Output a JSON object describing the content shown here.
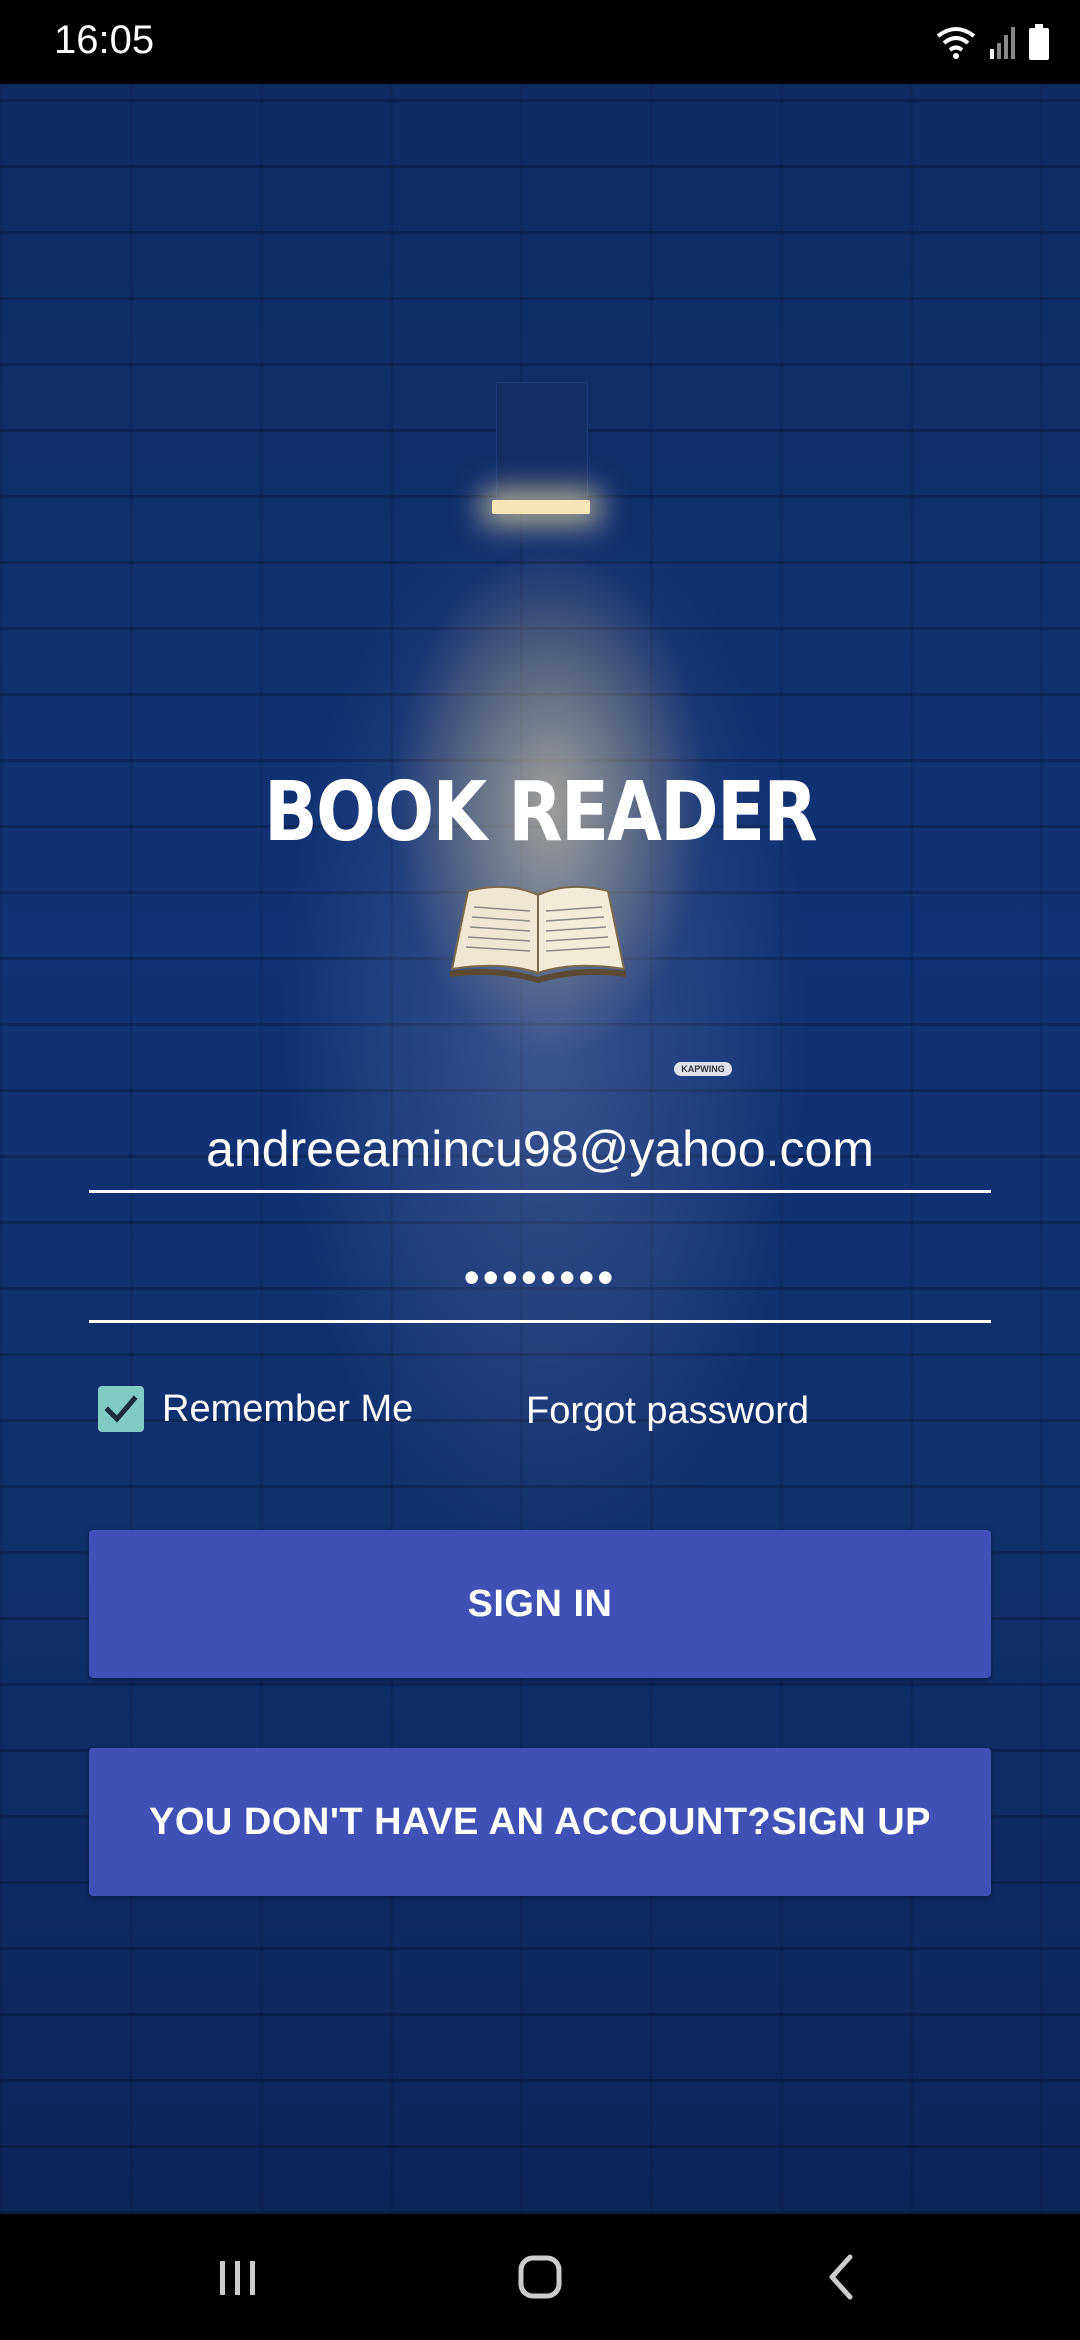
{
  "status_bar": {
    "time": "16:05",
    "icons": [
      "wifi-icon",
      "signal-icon",
      "battery-icon"
    ]
  },
  "app": {
    "title": "BOOK READER",
    "watermark": "KAPWING"
  },
  "login": {
    "email_value": "andreeamincu98@yahoo.com",
    "password_value": "••••••••",
    "remember_label": "Remember Me",
    "remember_checked": true,
    "forgot_label": "Forgot password",
    "signin_label": "SIGN IN",
    "signup_label": "YOU DON'T HAVE AN ACCOUNT?SIGN UP"
  },
  "colors": {
    "button": "#3f51b5",
    "checkbox": "#80cbc4",
    "wall": "#103276"
  },
  "nav_bar": {
    "icons": [
      "recent-apps-icon",
      "home-icon",
      "back-icon"
    ]
  }
}
